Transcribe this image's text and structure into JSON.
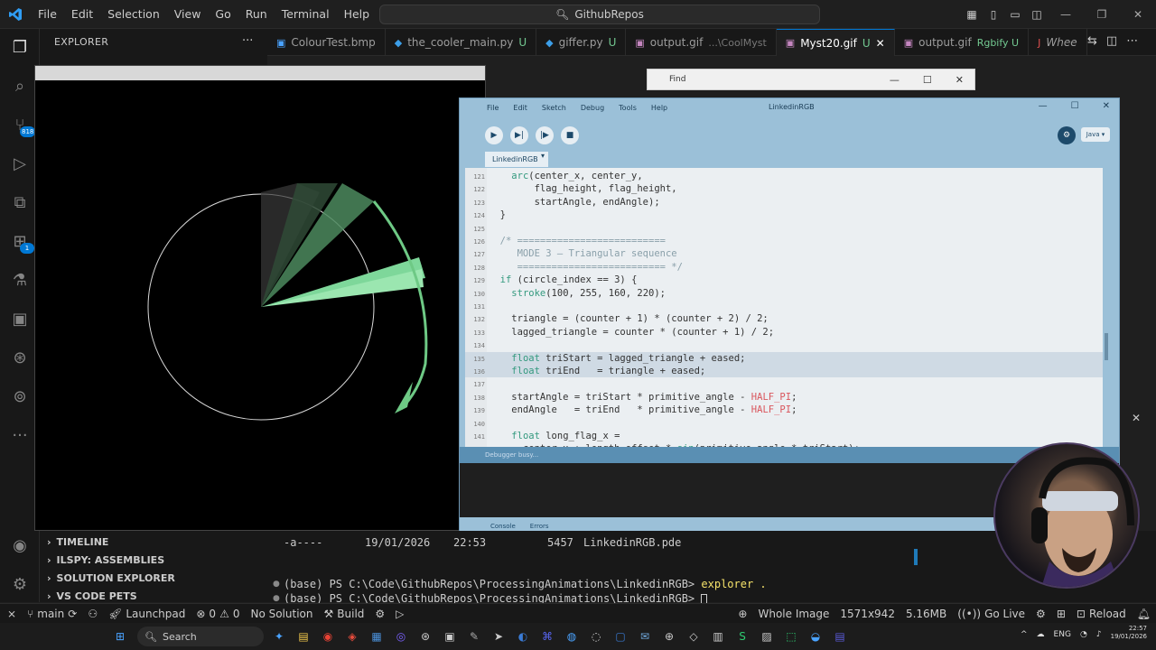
{
  "titlebar": {
    "menus": [
      "File",
      "Edit",
      "Selection",
      "View",
      "Go",
      "Run",
      "Terminal",
      "Help"
    ],
    "search_text": "GithubRepos"
  },
  "activity": {
    "source_control_badge": "818",
    "extensions_badge": "1"
  },
  "sidebar": {
    "header": "EXPLORER",
    "more": "···",
    "sections": [
      "TIMELINE",
      "ILSPY: ASSEMBLIES",
      "SOLUTION EXPLORER",
      "VS CODE PETS"
    ]
  },
  "tabs": [
    {
      "label": "ColourTest.bmp",
      "modified": "",
      "sub": ""
    },
    {
      "label": "the_cooler_main.py",
      "modified": "U",
      "sub": ""
    },
    {
      "label": "giffer.py",
      "modified": "U",
      "sub": ""
    },
    {
      "label": "output.gif",
      "modified": "",
      "sub": "...\\CoolMyst"
    },
    {
      "label": "Myst20.gif",
      "modified": "U",
      "sub": ""
    },
    {
      "label": "output.gif",
      "modified": "",
      "sub": "Rgbify U"
    },
    {
      "label": "Whee",
      "modified": "",
      "sub": ""
    }
  ],
  "find_window": {
    "title": "Find"
  },
  "pde": {
    "title": "LinkedinRGB",
    "menus": [
      "File",
      "Edit",
      "Sketch",
      "Debug",
      "Tools",
      "Help"
    ],
    "mode": "Java",
    "tab": "LinkedinRGB",
    "status": "Debugger busy...",
    "console_tabs": [
      "Console",
      "Errors"
    ],
    "code": [
      {
        "n": "121",
        "t": "    arc(center_x, center_y,"
      },
      {
        "n": "122",
        "t": "        flag_height, flag_height,"
      },
      {
        "n": "123",
        "t": "        startAngle, endAngle);"
      },
      {
        "n": "124",
        "t": "  }"
      },
      {
        "n": "125",
        "t": ""
      },
      {
        "n": "126",
        "t": "  /* =========================="
      },
      {
        "n": "127",
        "t": "     MODE 3 — Triangular sequence"
      },
      {
        "n": "128",
        "t": "     ========================== */"
      },
      {
        "n": "129",
        "t": "  if (circle_index == 3) {"
      },
      {
        "n": "130",
        "t": "    stroke(100, 255, 160, 220);"
      },
      {
        "n": "131",
        "t": ""
      },
      {
        "n": "132",
        "t": "    triangle = (counter + 1) * (counter + 2) / 2;"
      },
      {
        "n": "133",
        "t": "    lagged_triangle = counter * (counter + 1) / 2;"
      },
      {
        "n": "134",
        "t": ""
      },
      {
        "n": "135",
        "t": "    float triStart = lagged_triangle + eased;"
      },
      {
        "n": "136",
        "t": "    float triEnd   = triangle + eased;"
      },
      {
        "n": "137",
        "t": ""
      },
      {
        "n": "138",
        "t": "    startAngle = triStart * primitive_angle - HALF_PI;"
      },
      {
        "n": "139",
        "t": "    endAngle   = triEnd   * primitive_angle - HALF_PI;"
      },
      {
        "n": "140",
        "t": ""
      },
      {
        "n": "141",
        "t": "    float long_flag_x ="
      },
      {
        "n": "142",
        "t": "      center_x + length_offset * sin(primitive_angle * triStart);"
      }
    ]
  },
  "panel": {
    "row_mode": "-a----",
    "row_date": "19/01/2026",
    "row_time": "22:53",
    "row_size": "5457",
    "row_name": "LinkedinRGB.pde",
    "line1_prompt": "(base) PS C:\\Code\\GithubRepos\\ProcessingAnimations\\LinkedinRGB>",
    "line1_cmd": "explorer .",
    "line2_prompt": "(base) PS C:\\Code\\GithubRepos\\ProcessingAnimations\\LinkedinRGB>"
  },
  "statusbar": {
    "branch": "main",
    "launchpad": "Launchpad",
    "errors": "0",
    "warnings": "0",
    "solution": "No Solution",
    "build": "Build",
    "whole_image": "Whole Image",
    "dimensions": "1571x942",
    "size": "5.16MB",
    "go_live": "Go Live",
    "reload": "Reload"
  },
  "taskbar": {
    "search": "Search",
    "lang": "ENG",
    "time": "22:57",
    "date": "19/01/2026"
  },
  "colors": {
    "accent": "#0078d4",
    "untracked": "#73c991",
    "sketch_green": "#64ff a0"
  }
}
